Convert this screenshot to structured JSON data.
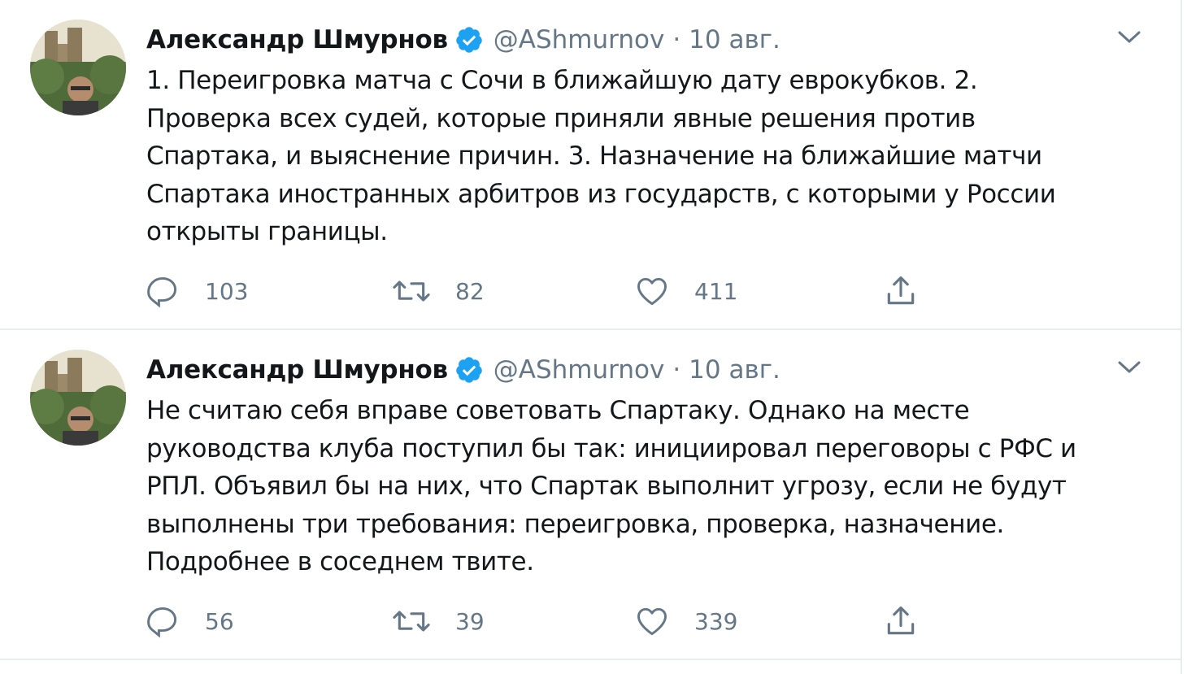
{
  "tweets": [
    {
      "author": {
        "name": "Александр Шмурнов",
        "handle": "@AShmurnov",
        "verified": true
      },
      "separator": "·",
      "time": "10 авг.",
      "text": "1. Переигровка матча с Сочи в ближайшую дату еврокубков. 2.\nПроверка всех судей, которые приняли явные решения против\nСпартака, и выяснение причин. 3. Назначение на ближайшие матчи\nСпартака иностранных арбитров из государств, с которыми у России\nоткрыты границы.",
      "stats": {
        "replies": "103",
        "retweets": "82",
        "likes": "411"
      },
      "icons": {
        "menu": "chevron-down-icon",
        "reply": "reply-icon",
        "retweet": "retweet-icon",
        "like": "heart-icon",
        "share": "share-icon"
      }
    },
    {
      "author": {
        "name": "Александр Шмурнов",
        "handle": "@AShmurnov",
        "verified": true
      },
      "separator": "·",
      "time": "10 авг.",
      "text": "Не считаю себя вправе советовать Спартаку. Однако на месте\nруководства клуба поступил бы так: инициировал переговоры с РФС и\nРПЛ. Объявил бы на них, что Спартак выполнит угрозу, если не будут\nвыполнены три требования: переигровка, проверка, назначение.\nПодробнее в соседнем твите.",
      "stats": {
        "replies": "56",
        "retweets": "39",
        "likes": "339"
      },
      "icons": {
        "menu": "chevron-down-icon",
        "reply": "reply-icon",
        "retweet": "retweet-icon",
        "like": "heart-icon",
        "share": "share-icon"
      }
    }
  ],
  "colors": {
    "text": "#14171a",
    "secondary": "#657786",
    "verified": "#1da1f2",
    "divider": "#e6ecf0"
  }
}
